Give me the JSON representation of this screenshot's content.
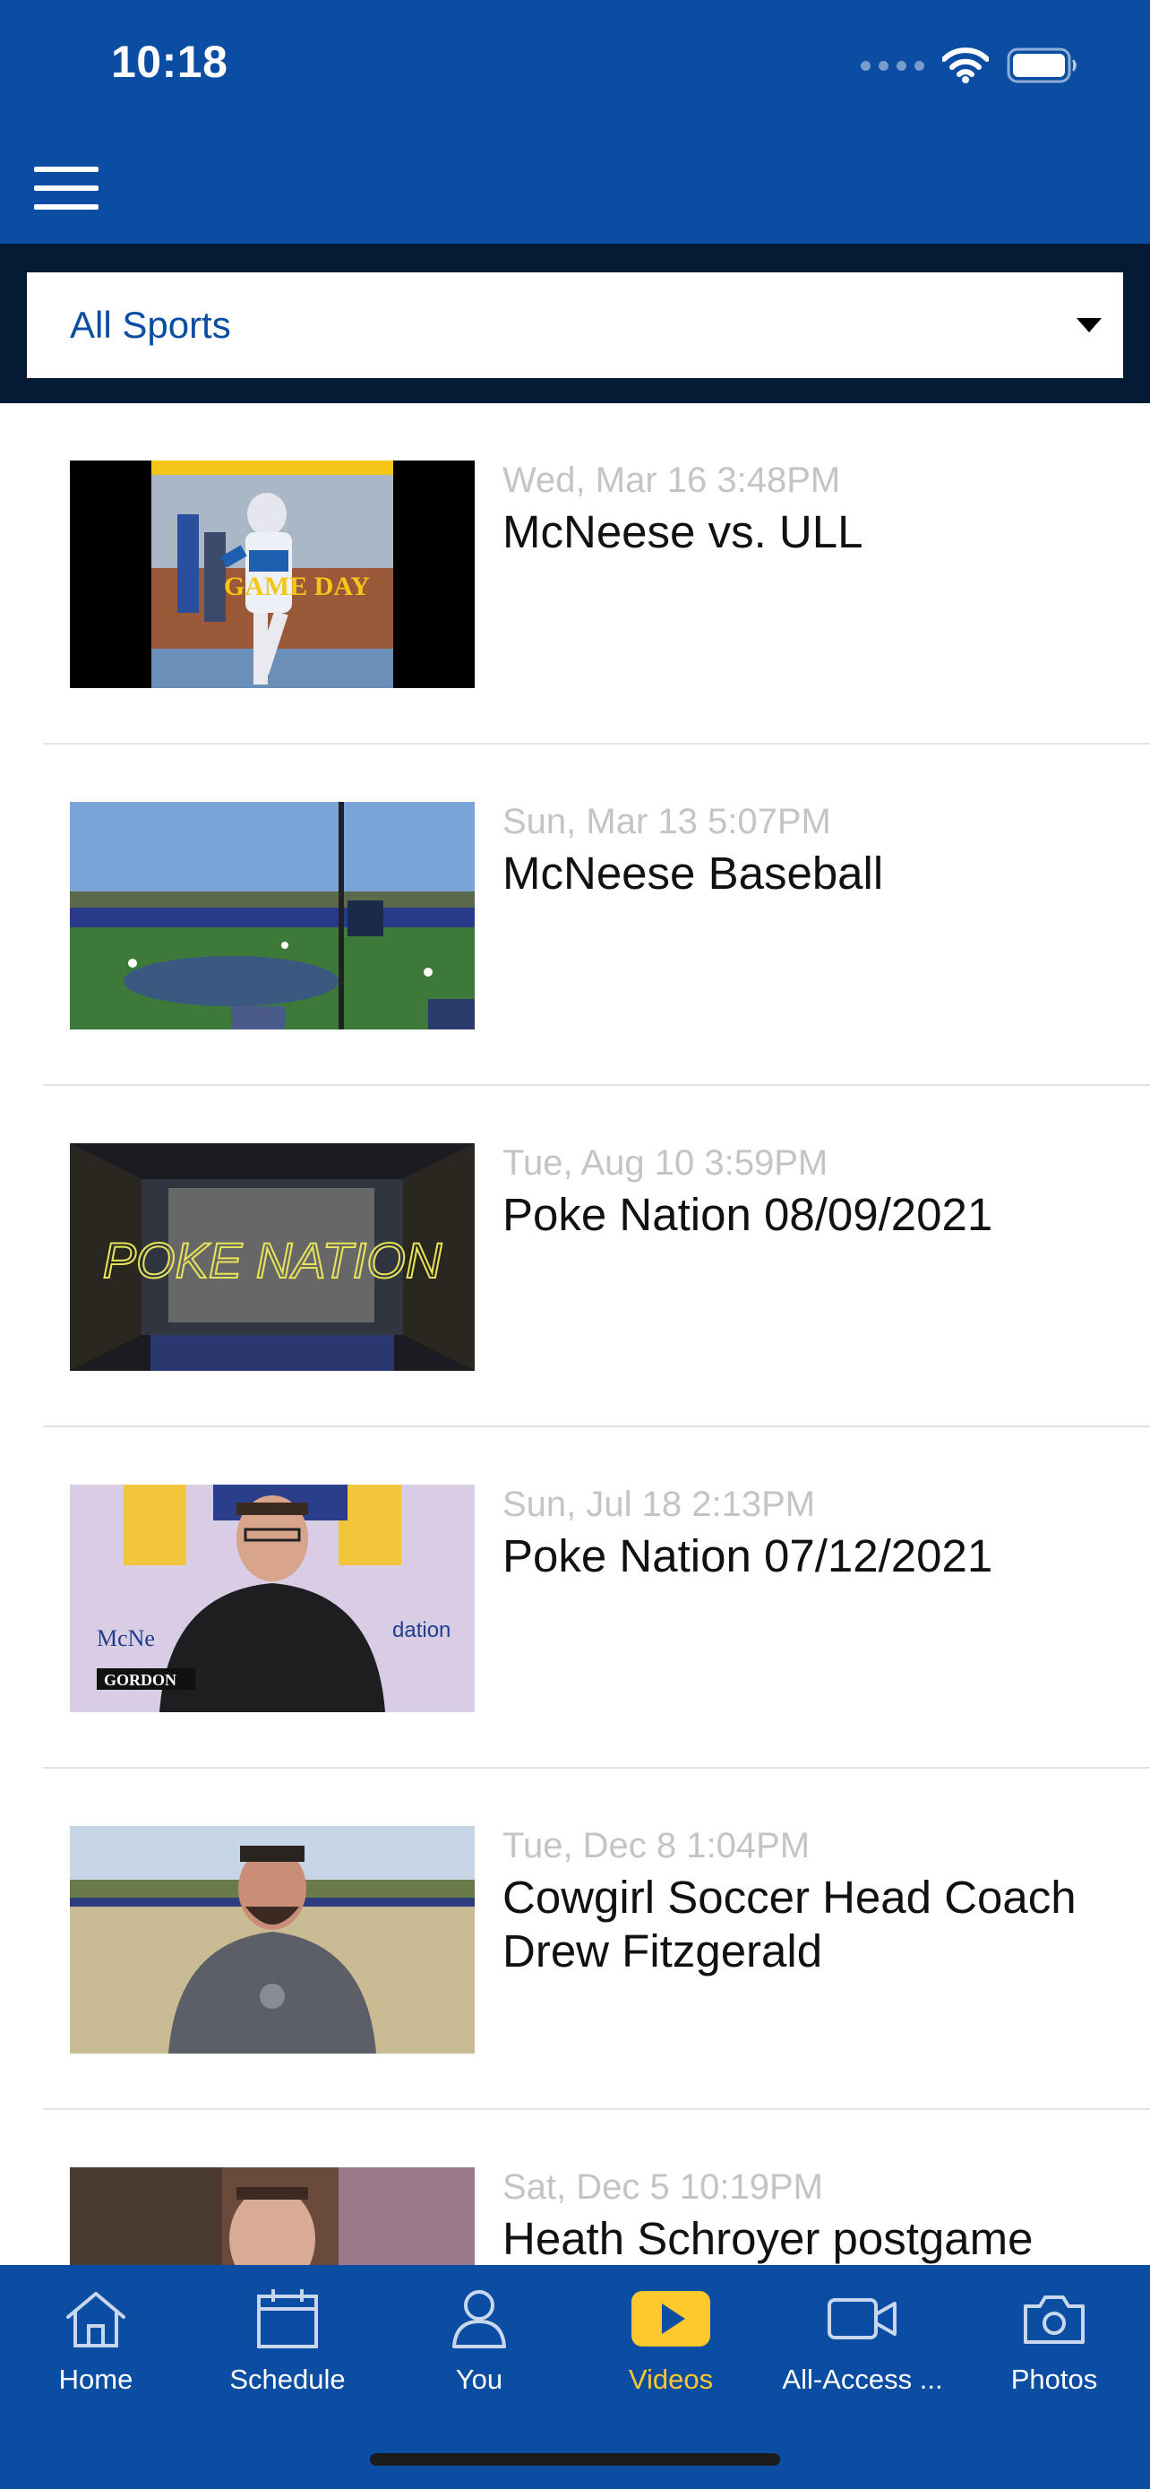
{
  "status_bar": {
    "time": "10:18"
  },
  "filter": {
    "selected": "All Sports"
  },
  "videos": [
    {
      "date": "Wed, Mar 16 3:48PM",
      "title": "McNeese vs. ULL"
    },
    {
      "date": "Sun, Mar 13 5:07PM",
      "title": "McNeese Baseball"
    },
    {
      "date": "Tue, Aug 10 3:59PM",
      "title": "Poke Nation 08/09/2021"
    },
    {
      "date": "Sun, Jul 18 2:13PM",
      "title": "Poke Nation 07/12/2021"
    },
    {
      "date": "Tue, Dec 8 1:04PM",
      "title": "Cowgirl Soccer Head Coach Drew Fitzgerald"
    },
    {
      "date": "Sat, Dec 5 10:19PM",
      "title": "Heath Schroyer postgame"
    }
  ],
  "thumb_text": {
    "game_day": "GAME DAY",
    "poke_nation": "POKE NATION",
    "gordon": "GORDON",
    "foundation": "dation",
    "mcne": "McNe"
  },
  "tabbar": {
    "tabs": [
      {
        "label": "Home",
        "icon": "home-icon"
      },
      {
        "label": "Schedule",
        "icon": "calendar-icon"
      },
      {
        "label": "You",
        "icon": "person-icon"
      },
      {
        "label": "Videos",
        "icon": "play-icon",
        "active": true
      },
      {
        "label": "All-Access ...",
        "icon": "video-camera-icon"
      },
      {
        "label": "Photos",
        "icon": "camera-icon"
      }
    ]
  },
  "colors": {
    "brand_blue": "#0a4da2",
    "filter_bar_navy": "#051a35",
    "active_gold": "#ffc82c"
  }
}
